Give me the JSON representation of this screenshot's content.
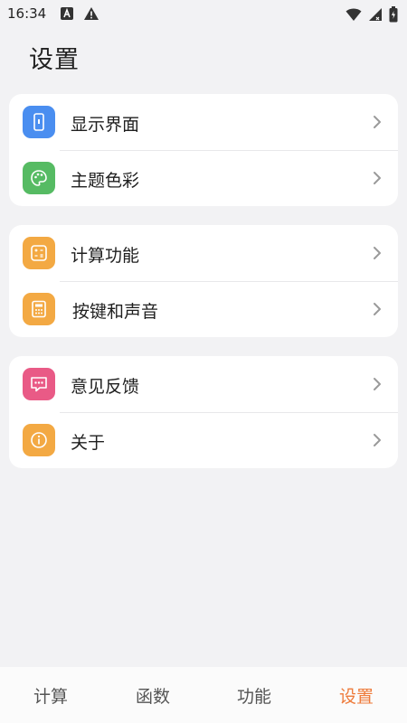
{
  "status_bar": {
    "time": "16:34",
    "left_icons": [
      "app-notification-icon",
      "warning-icon"
    ],
    "right_icons": [
      "wifi-icon",
      "signal-icon",
      "battery-icon"
    ]
  },
  "page_title": "设置",
  "groups": [
    {
      "items": [
        {
          "label": "显示界面",
          "icon": "display-icon",
          "color": "#4a8ef0"
        },
        {
          "label": "主题色彩",
          "icon": "palette-icon",
          "color": "#56bb63"
        }
      ]
    },
    {
      "items": [
        {
          "label": "计算功能",
          "icon": "calculation-icon",
          "color": "#f3a943"
        },
        {
          "label": "按键和声音",
          "icon": "keypad-icon",
          "color": "#f3a943"
        }
      ]
    },
    {
      "items": [
        {
          "label": "意见反馈",
          "icon": "feedback-icon",
          "color": "#e95a86"
        },
        {
          "label": "关于",
          "icon": "info-icon",
          "color": "#f3a943"
        }
      ]
    }
  ],
  "tabs": [
    {
      "label": "计算",
      "active": false
    },
    {
      "label": "函数",
      "active": false
    },
    {
      "label": "功能",
      "active": false
    },
    {
      "label": "设置",
      "active": true
    }
  ],
  "colors": {
    "accent": "#ee7a3a",
    "background": "#f2f2f4",
    "card": "#ffffff"
  }
}
